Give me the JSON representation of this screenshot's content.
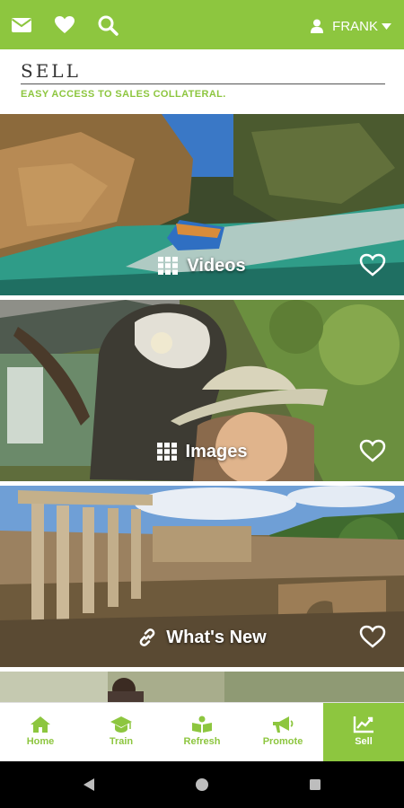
{
  "topbar": {
    "icons": [
      "mail-icon",
      "heart-icon",
      "search-icon"
    ],
    "user_name": "FRANK",
    "user_icon": "person-icon",
    "dropdown_icon": "caret-down-icon",
    "color": "#8dc63f"
  },
  "heading": {
    "title": "SELL",
    "subtitle": "EASY ACCESS TO SALES COLLATERAL."
  },
  "tiles": [
    {
      "label": "Videos",
      "icon": "grid-icon",
      "favorite": false
    },
    {
      "label": "Images",
      "icon": "grid-icon",
      "favorite": false
    },
    {
      "label": "What's New",
      "icon": "link-icon",
      "favorite": false
    }
  ],
  "bottom_nav": {
    "items": [
      {
        "label": "Home",
        "icon": "home-icon",
        "active": false
      },
      {
        "label": "Train",
        "icon": "graduation-cap-icon",
        "active": false
      },
      {
        "label": "Refresh",
        "icon": "book-icon",
        "active": false
      },
      {
        "label": "Promote",
        "icon": "megaphone-icon",
        "active": false
      },
      {
        "label": "Sell",
        "icon": "chart-icon",
        "active": true
      }
    ]
  },
  "system_nav": [
    "back-button",
    "home-button",
    "recents-button"
  ]
}
